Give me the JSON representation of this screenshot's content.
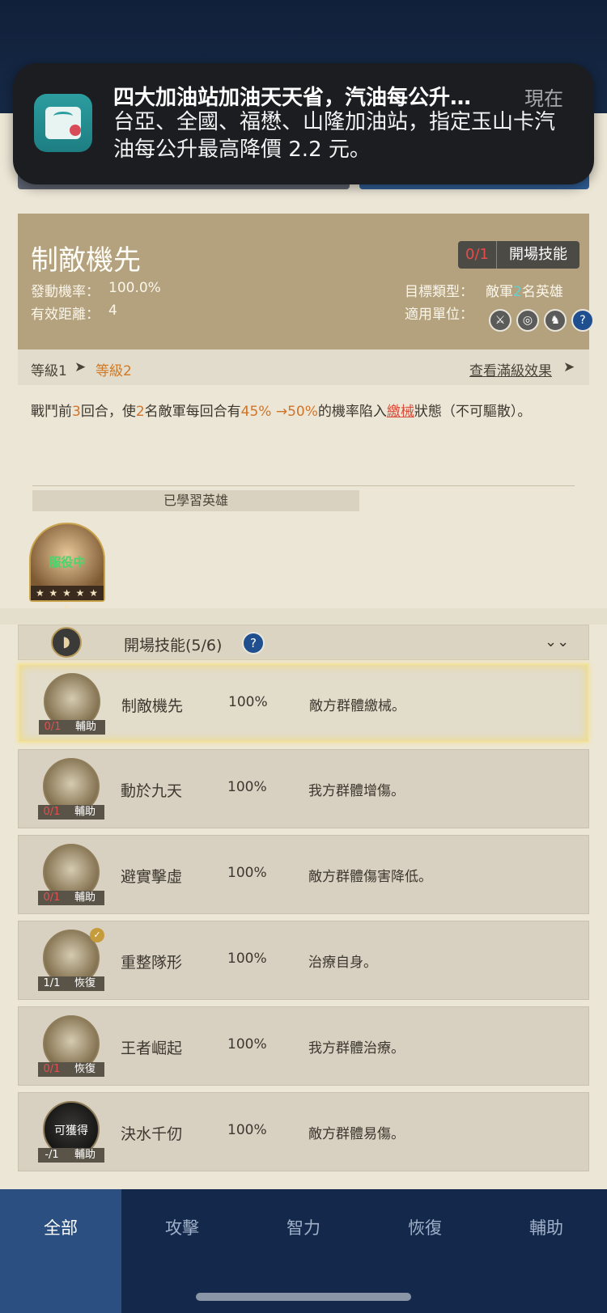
{
  "notification": {
    "title": "四大加油站加油天天省，汽油每公升…",
    "time": "現在",
    "body": "台亞、全國、福懋、山隆加油站，指定玉山卡汽油每公升最高降價 2.2 元。",
    "app_icon": "wallet-card-icon"
  },
  "skill": {
    "name": "制敵機先",
    "count": "0/1",
    "type": "開場技能",
    "trigger_label": "發動機率：",
    "trigger_value": "100.0%",
    "range_label": "有效距離：",
    "range_value": "4",
    "target_label": "目標類型：",
    "target_value_prefix": "敵軍",
    "target_value_num": "2",
    "target_value_suffix": "名英雄",
    "unit_label": "適用單位：",
    "unit_icons": [
      "sword-icon",
      "target-icon",
      "horse-icon",
      "help-icon"
    ],
    "level_current": "等級1",
    "level_next": "等級2",
    "view_full": "查看滿級效果",
    "desc": {
      "p1": "戰鬥前",
      "n1": "3",
      "p2": "回合，使",
      "n2": "2",
      "p3": "名敵軍每回合有",
      "n3": "45%",
      "arrow": " →",
      "n4": "50%",
      "p4": "的機率陷入",
      "status": "繳械",
      "p5": "狀態（不可驅散）。"
    },
    "learned_heading": "已學習英雄",
    "hero_status": "服役中",
    "hero_stars": "★ ★ ★ ★ ★ ★"
  },
  "section": {
    "title": "開場技能(5/6)",
    "help": "?",
    "chevron": "⌄⌄"
  },
  "skills": [
    {
      "name": "制敵機先",
      "pct": "100%",
      "effect": "敵方群體繳械。",
      "count": "0/1",
      "category": "輔助"
    },
    {
      "name": "動於九天",
      "pct": "100%",
      "effect": "我方群體增傷。",
      "count": "0/1",
      "category": "輔助"
    },
    {
      "name": "避實擊虛",
      "pct": "100%",
      "effect": "敵方群體傷害降低。",
      "count": "0/1",
      "category": "輔助"
    },
    {
      "name": "重整隊形",
      "pct": "100%",
      "effect": "治療自身。",
      "count": "1/1",
      "category": "恢復"
    },
    {
      "name": "王者崛起",
      "pct": "100%",
      "effect": "我方群體治療。",
      "count": "0/1",
      "category": "恢復"
    },
    {
      "name": "決水千仞",
      "pct": "100%",
      "effect": "敵方群體易傷。",
      "count": "-/1",
      "category": "輔助",
      "obtainable": "可獲得"
    }
  ],
  "tabs": [
    "全部",
    "攻擊",
    "智力",
    "恢復",
    "輔助"
  ]
}
